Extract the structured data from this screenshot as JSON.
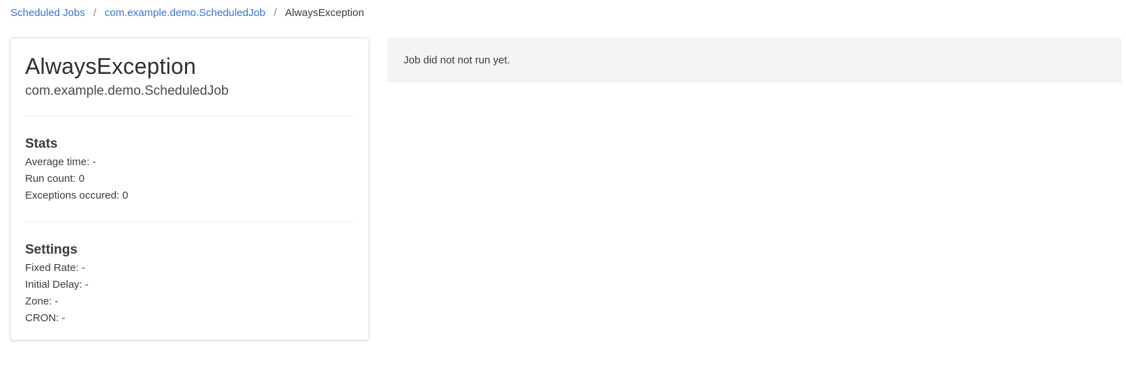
{
  "breadcrumb": {
    "items": [
      {
        "label": "Scheduled Jobs"
      },
      {
        "label": "com.example.demo.ScheduledJob"
      }
    ],
    "separator": "/",
    "current": "AlwaysException"
  },
  "job": {
    "name": "AlwaysException",
    "class_name": "com.example.demo.ScheduledJob"
  },
  "stats": {
    "title": "Stats",
    "rows": [
      "Average time: -",
      "Run count: 0",
      "Exceptions occured: 0"
    ]
  },
  "settings": {
    "title": "Settings",
    "rows": [
      "Fixed Rate: -",
      "Initial Delay: -",
      "Zone: -",
      "CRON: -"
    ]
  },
  "notice": {
    "text": "Job did not not run yet."
  },
  "colors": {
    "link": "#3a72d8",
    "text": "#3b3b3b",
    "notice_bg": "#f4f4f4",
    "card_border": "#dedede"
  }
}
